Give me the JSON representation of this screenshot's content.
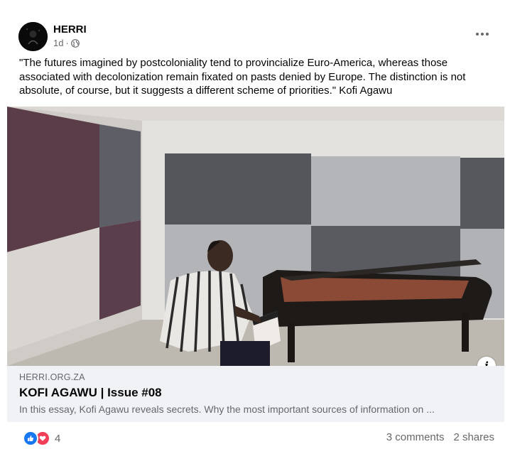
{
  "post": {
    "author": "HERRI",
    "time": "1d",
    "privacy_icon": "globe-icon",
    "text": "\"The futures imagined by postcoloniality tend to provincialize Euro-America, whereas those associated with decolonization remain fixated on pasts denied by Europe. The distinction is not absolute, of course, but it suggests a different scheme of priorities.\" Kofi Agawu"
  },
  "link": {
    "domain": "HERRI.ORG.ZA",
    "title": "KOFI AGAWU | Issue #08",
    "description": "In this essay, Kofi Agawu reveals secrets. Why the most important sources of information on ..."
  },
  "footer": {
    "reaction_count": "4",
    "comments": "3 comments",
    "shares": "2 shares"
  },
  "colors": {
    "like": "#1877f2",
    "love": "#f33e58",
    "card_bg": "#f0f2f5",
    "muted_text": "#65676b"
  }
}
